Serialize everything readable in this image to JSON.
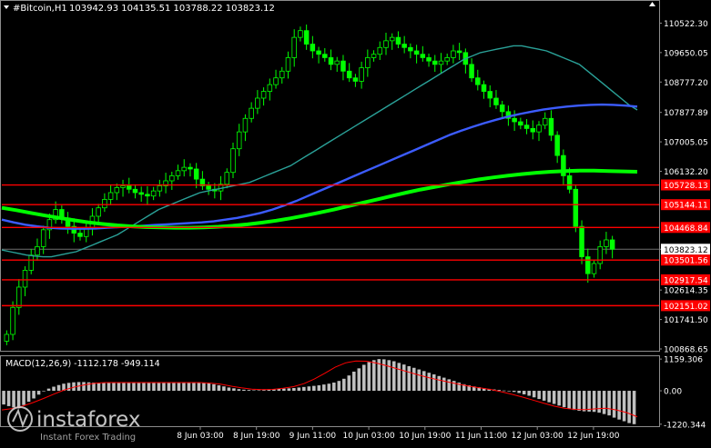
{
  "header": {
    "symbol": "#Bitcoin,H1",
    "ohlc": "103942.93 104135.51 103788.22 103823.12"
  },
  "indicator": {
    "label": "MACD(12,26,9) -1112.178 -949.114"
  },
  "watermark": {
    "brand": "instaforex",
    "tagline": "Instant Forex Trading"
  },
  "colors": {
    "background": "#000000",
    "candle": "#00ff00",
    "ma_fast": "#2aa198",
    "ma_mid": "#3c5cff",
    "ma_slow": "#00ff00",
    "level": "#ff0000",
    "macd_hist": "#c0c0c0",
    "macd_signal": "#ff0000"
  },
  "chart_data": [
    {
      "type": "candlestick",
      "ylim": [
        100868.65,
        111100
      ],
      "price_ticks": [
        "110522.30",
        "109650.05",
        "108777.20",
        "107877.89",
        "107005.05",
        "106132.20",
        "103823.12",
        "102614.35",
        "101741.50",
        "100868.65"
      ],
      "price_tick_values": [
        110522.3,
        109650.05,
        108777.2,
        107877.89,
        107005.05,
        106132.2,
        103823.12,
        102614.35,
        101741.5,
        100868.65
      ],
      "current_price": 103823.12,
      "levels": [
        {
          "label": "105728.13",
          "value": 105728.13
        },
        {
          "label": "105144.11",
          "value": 105144.11
        },
        {
          "label": "104468.84",
          "value": 104468.84
        },
        {
          "label": "103501.56",
          "value": 103501.56
        },
        {
          "label": "102917.54",
          "value": 102917.54
        },
        {
          "label": "102151.02",
          "value": 102151.02
        }
      ],
      "time_ticks": [
        "8 Jun 03:00",
        "8 Jun 19:00",
        "9 Jun 11:00",
        "10 Jun 03:00",
        "10 Jun 19:00",
        "11 Jun 11:00",
        "12 Jun 03:00",
        "12 Jun 19:00"
      ],
      "close_series": [
        101300,
        102100,
        102700,
        103200,
        103650,
        103900,
        104400,
        104700,
        105000,
        104750,
        104500,
        104300,
        104200,
        104450,
        104800,
        105050,
        105300,
        105500,
        105650,
        105700,
        105600,
        105500,
        105450,
        105400,
        105550,
        105700,
        105850,
        106000,
        106150,
        106250,
        106200,
        105900,
        105700,
        105600,
        105550,
        105750,
        106100,
        106800,
        107300,
        107700,
        108000,
        108300,
        108500,
        108700,
        108900,
        109100,
        109500,
        110100,
        110300,
        109900,
        109700,
        109600,
        109500,
        109300,
        109400,
        109100,
        108900,
        108800,
        109200,
        109500,
        109600,
        109800,
        110000,
        110100,
        109900,
        109800,
        109700,
        109600,
        109500,
        109400,
        109300,
        109400,
        109500,
        109700,
        109650,
        109300,
        108900,
        108700,
        108500,
        108300,
        108100,
        107900,
        107700,
        107600,
        107500,
        107400,
        107300,
        107500,
        107700,
        107200,
        106600,
        106000,
        105600,
        104500,
        103600,
        103100,
        103400,
        103900,
        104100,
        103823
      ],
      "ma_fast": [
        103800,
        103750,
        103700,
        103650,
        103620,
        103600,
        103600,
        103650,
        103700,
        103750,
        103850,
        103950,
        104050,
        104150,
        104250,
        104400,
        104550,
        104700,
        104850,
        105000,
        105100,
        105200,
        105300,
        105400,
        105500,
        105550,
        105600,
        105650,
        105700,
        105750,
        105800,
        105900,
        106000,
        106100,
        106200,
        106300,
        106450,
        106600,
        106750,
        106900,
        107050,
        107200,
        107350,
        107500,
        107650,
        107800,
        107950,
        108100,
        108250,
        108400,
        108550,
        108700,
        108850,
        109000,
        109150,
        109300,
        109450,
        109550,
        109650,
        109700,
        109750,
        109800,
        109850,
        109850,
        109800,
        109750,
        109700,
        109600,
        109500,
        109400,
        109300,
        109100,
        108900,
        108700,
        108500,
        108300,
        108100,
        107950
      ],
      "ma_mid": [
        104700,
        104620,
        104550,
        104500,
        104460,
        104440,
        104430,
        104430,
        104440,
        104460,
        104480,
        104500,
        104520,
        104540,
        104560,
        104580,
        104600,
        104620,
        104650,
        104700,
        104750,
        104820,
        104900,
        105000,
        105120,
        105250,
        105400,
        105550,
        105700,
        105850,
        106000,
        106150,
        106300,
        106450,
        106600,
        106750,
        106900,
        107050,
        107200,
        107330,
        107450,
        107560,
        107660,
        107750,
        107830,
        107900,
        107960,
        108010,
        108050,
        108080,
        108100,
        108110,
        108100,
        108080,
        108050
      ],
      "ma_slow": [
        105050,
        104980,
        104900,
        104820,
        104750,
        104680,
        104620,
        104570,
        104530,
        104500,
        104480,
        104470,
        104460,
        104460,
        104470,
        104490,
        104520,
        104560,
        104610,
        104670,
        104740,
        104820,
        104910,
        105000,
        105100,
        105200,
        105300,
        105400,
        105500,
        105590,
        105670,
        105750,
        105820,
        105890,
        105950,
        106000,
        106050,
        106090,
        106120,
        106140,
        106150,
        106150,
        106140,
        106130,
        106120
      ]
    },
    {
      "type": "bar",
      "name": "MACD",
      "ylim": [
        -1260,
        1230
      ],
      "tick_labels": [
        "1159.306",
        "0.00",
        "-1220.344"
      ],
      "tick_values": [
        1159.306,
        0,
        -1220.344
      ],
      "histogram": [
        -500,
        -560,
        -610,
        -640,
        -520,
        -400,
        -280,
        -140,
        -20,
        80,
        150,
        210,
        260,
        290,
        310,
        320,
        320,
        310,
        300,
        300,
        300,
        300,
        300,
        300,
        300,
        300,
        300,
        300,
        300,
        300,
        300,
        300,
        300,
        300,
        300,
        300,
        300,
        300,
        300,
        300,
        290,
        270,
        240,
        200,
        160,
        120,
        90,
        60,
        40,
        30,
        20,
        20,
        30,
        50,
        60,
        70,
        80,
        90,
        100,
        120,
        140,
        160,
        180,
        200,
        230,
        260,
        300,
        360,
        440,
        560,
        700,
        820,
        950,
        1050,
        1120,
        1159,
        1150,
        1120,
        1080,
        1020,
        960,
        900,
        840,
        780,
        720,
        660,
        600,
        540,
        480,
        420,
        360,
        300,
        240,
        200,
        160,
        130,
        100,
        70,
        50,
        30,
        10,
        -10,
        -40,
        -80,
        -130,
        -180,
        -240,
        -300,
        -360,
        -420,
        -480,
        -540,
        -600,
        -650,
        -700,
        -730,
        -750,
        -760,
        -770,
        -800,
        -850,
        -900,
        -980,
        -1050,
        -1112,
        -1180,
        -1220
      ],
      "signal": [
        -700,
        -650,
        -560,
        -430,
        -280,
        -120,
        30,
        140,
        220,
        280,
        300,
        300,
        300,
        300,
        300,
        300,
        300,
        300,
        300,
        300,
        280,
        240,
        170,
        110,
        60,
        40,
        50,
        90,
        150,
        260,
        430,
        640,
        860,
        1020,
        1090,
        1080,
        1010,
        910,
        800,
        690,
        580,
        480,
        390,
        310,
        230,
        160,
        100,
        40,
        -40,
        -130,
        -230,
        -340,
        -450,
        -560,
        -640,
        -680,
        -690,
        -660,
        -640,
        -700,
        -800,
        -949
      ]
    }
  ]
}
